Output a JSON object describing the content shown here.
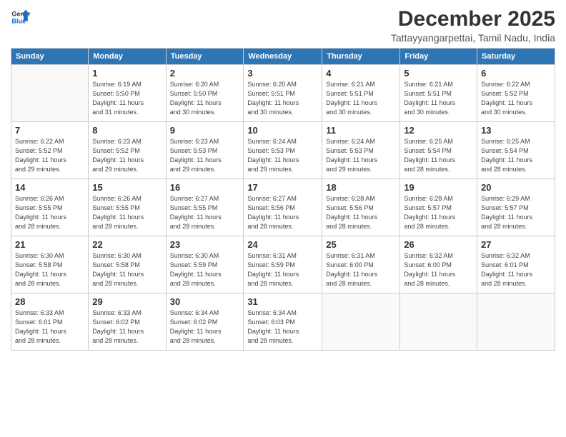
{
  "header": {
    "logo_line1": "General",
    "logo_line2": "Blue",
    "month": "December 2025",
    "location": "Tattayyangarpettai, Tamil Nadu, India"
  },
  "weekdays": [
    "Sunday",
    "Monday",
    "Tuesday",
    "Wednesday",
    "Thursday",
    "Friday",
    "Saturday"
  ],
  "weeks": [
    [
      {
        "day": "",
        "info": ""
      },
      {
        "day": "1",
        "info": "Sunrise: 6:19 AM\nSunset: 5:50 PM\nDaylight: 11 hours\nand 31 minutes."
      },
      {
        "day": "2",
        "info": "Sunrise: 6:20 AM\nSunset: 5:50 PM\nDaylight: 11 hours\nand 30 minutes."
      },
      {
        "day": "3",
        "info": "Sunrise: 6:20 AM\nSunset: 5:51 PM\nDaylight: 11 hours\nand 30 minutes."
      },
      {
        "day": "4",
        "info": "Sunrise: 6:21 AM\nSunset: 5:51 PM\nDaylight: 11 hours\nand 30 minutes."
      },
      {
        "day": "5",
        "info": "Sunrise: 6:21 AM\nSunset: 5:51 PM\nDaylight: 11 hours\nand 30 minutes."
      },
      {
        "day": "6",
        "info": "Sunrise: 6:22 AM\nSunset: 5:52 PM\nDaylight: 11 hours\nand 30 minutes."
      }
    ],
    [
      {
        "day": "7",
        "info": "Sunrise: 6:22 AM\nSunset: 5:52 PM\nDaylight: 11 hours\nand 29 minutes."
      },
      {
        "day": "8",
        "info": "Sunrise: 6:23 AM\nSunset: 5:52 PM\nDaylight: 11 hours\nand 29 minutes."
      },
      {
        "day": "9",
        "info": "Sunrise: 6:23 AM\nSunset: 5:53 PM\nDaylight: 11 hours\nand 29 minutes."
      },
      {
        "day": "10",
        "info": "Sunrise: 6:24 AM\nSunset: 5:53 PM\nDaylight: 11 hours\nand 29 minutes."
      },
      {
        "day": "11",
        "info": "Sunrise: 6:24 AM\nSunset: 5:53 PM\nDaylight: 11 hours\nand 29 minutes."
      },
      {
        "day": "12",
        "info": "Sunrise: 6:25 AM\nSunset: 5:54 PM\nDaylight: 11 hours\nand 28 minutes."
      },
      {
        "day": "13",
        "info": "Sunrise: 6:25 AM\nSunset: 5:54 PM\nDaylight: 11 hours\nand 28 minutes."
      }
    ],
    [
      {
        "day": "14",
        "info": "Sunrise: 6:26 AM\nSunset: 5:55 PM\nDaylight: 11 hours\nand 28 minutes."
      },
      {
        "day": "15",
        "info": "Sunrise: 6:26 AM\nSunset: 5:55 PM\nDaylight: 11 hours\nand 28 minutes."
      },
      {
        "day": "16",
        "info": "Sunrise: 6:27 AM\nSunset: 5:55 PM\nDaylight: 11 hours\nand 28 minutes."
      },
      {
        "day": "17",
        "info": "Sunrise: 6:27 AM\nSunset: 5:56 PM\nDaylight: 11 hours\nand 28 minutes."
      },
      {
        "day": "18",
        "info": "Sunrise: 6:28 AM\nSunset: 5:56 PM\nDaylight: 11 hours\nand 28 minutes."
      },
      {
        "day": "19",
        "info": "Sunrise: 6:28 AM\nSunset: 5:57 PM\nDaylight: 11 hours\nand 28 minutes."
      },
      {
        "day": "20",
        "info": "Sunrise: 6:29 AM\nSunset: 5:57 PM\nDaylight: 11 hours\nand 28 minutes."
      }
    ],
    [
      {
        "day": "21",
        "info": "Sunrise: 6:30 AM\nSunset: 5:58 PM\nDaylight: 11 hours\nand 28 minutes."
      },
      {
        "day": "22",
        "info": "Sunrise: 6:30 AM\nSunset: 5:58 PM\nDaylight: 11 hours\nand 28 minutes."
      },
      {
        "day": "23",
        "info": "Sunrise: 6:30 AM\nSunset: 5:59 PM\nDaylight: 11 hours\nand 28 minutes."
      },
      {
        "day": "24",
        "info": "Sunrise: 6:31 AM\nSunset: 5:59 PM\nDaylight: 11 hours\nand 28 minutes."
      },
      {
        "day": "25",
        "info": "Sunrise: 6:31 AM\nSunset: 6:00 PM\nDaylight: 11 hours\nand 28 minutes."
      },
      {
        "day": "26",
        "info": "Sunrise: 6:32 AM\nSunset: 6:00 PM\nDaylight: 11 hours\nand 28 minutes."
      },
      {
        "day": "27",
        "info": "Sunrise: 6:32 AM\nSunset: 6:01 PM\nDaylight: 11 hours\nand 28 minutes."
      }
    ],
    [
      {
        "day": "28",
        "info": "Sunrise: 6:33 AM\nSunset: 6:01 PM\nDaylight: 11 hours\nand 28 minutes."
      },
      {
        "day": "29",
        "info": "Sunrise: 6:33 AM\nSunset: 6:02 PM\nDaylight: 11 hours\nand 28 minutes."
      },
      {
        "day": "30",
        "info": "Sunrise: 6:34 AM\nSunset: 6:02 PM\nDaylight: 11 hours\nand 28 minutes."
      },
      {
        "day": "31",
        "info": "Sunrise: 6:34 AM\nSunset: 6:03 PM\nDaylight: 11 hours\nand 28 minutes."
      },
      {
        "day": "",
        "info": ""
      },
      {
        "day": "",
        "info": ""
      },
      {
        "day": "",
        "info": ""
      }
    ]
  ]
}
